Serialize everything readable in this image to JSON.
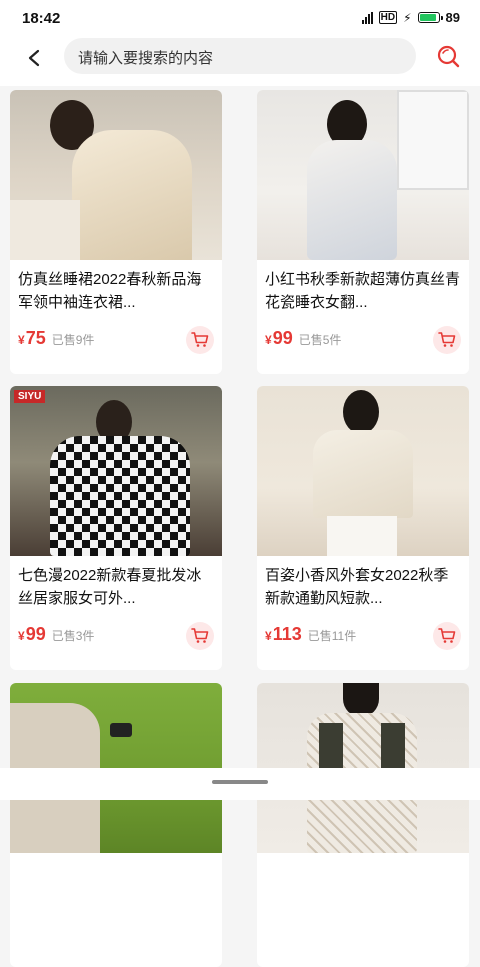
{
  "status": {
    "time": "18:42",
    "battery": "89",
    "network": "HD"
  },
  "header": {
    "search_placeholder": "请输入要搜索的内容"
  },
  "products": [
    {
      "title": "仿真丝睡裙2022春秋新品海军领中袖连衣裙...",
      "currency": "¥",
      "price": "75",
      "sold": "已售9件"
    },
    {
      "title": "小红书秋季新款超薄仿真丝青花瓷睡衣女翻...",
      "currency": "¥",
      "price": "99",
      "sold": "已售5件"
    },
    {
      "title": "七色漫2022新款春夏批发冰丝居家服女可外...",
      "currency": "¥",
      "price": "99",
      "sold": "已售3件",
      "badge": "SIYU"
    },
    {
      "title": "百姿小香风外套女2022秋季新款通勤风短款...",
      "currency": "¥",
      "price": "113",
      "sold": "已售11件"
    },
    {
      "title": "",
      "currency": "",
      "price": "",
      "sold": ""
    },
    {
      "title": "",
      "currency": "",
      "price": "",
      "sold": ""
    }
  ],
  "colors": {
    "accent": "#e53935",
    "cart_bg": "#fde8e8"
  }
}
